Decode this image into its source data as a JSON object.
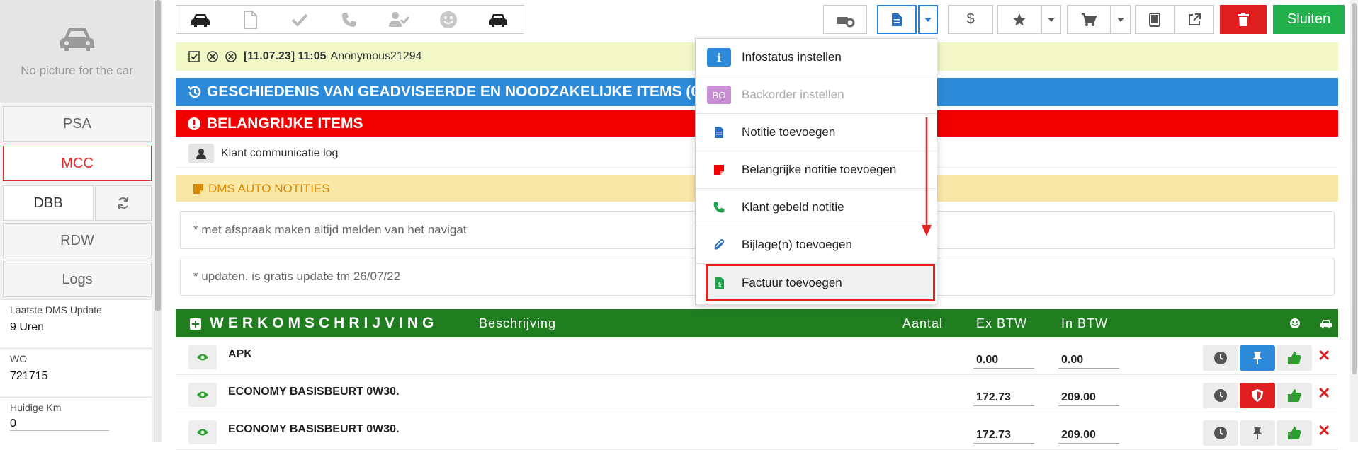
{
  "sidebar": {
    "no_picture": "No picture for the car",
    "buttons": {
      "psa": "PSA",
      "mcc": "MCC",
      "dbb": "DBB",
      "rdw": "RDW",
      "logs": "Logs"
    },
    "info": [
      {
        "label": "Laatste DMS Update",
        "value": "9 Uren"
      },
      {
        "label": "WO",
        "value": "721715"
      },
      {
        "label": "Huidige Km",
        "value": "0"
      }
    ]
  },
  "toolbar": {
    "close_label": "Sluiten",
    "icons": [
      "car-icon",
      "file-icon",
      "check-icon",
      "phone-icon",
      "user-check-icon",
      "smiley-icon",
      "car-icon",
      "car-key-icon",
      "document-icon",
      "dollar-icon",
      "star-icon",
      "cart-icon",
      "tablet-icon",
      "external-link-icon",
      "trash-icon"
    ]
  },
  "info_row": {
    "date": "[11.07.23] 11:05",
    "user": "Anonymous21294"
  },
  "bands": {
    "history": "GESCHIEDENIS VAN GEADVISEERDE EN NOODZAKELIJKE ITEMS (0)",
    "important": "BELANGRIJKE ITEMS",
    "klant_log": "Klant communicatie log",
    "dms_auto": "DMS AUTO NOTITIES"
  },
  "notes": [
    "* met afspraak maken altijd melden van het navigat",
    "* updaten. is gratis update tm 26/07/22"
  ],
  "werk": {
    "title": "WERKOMSCHRIJVING",
    "col_desc": "Beschrijving",
    "col_qty": "Aantal",
    "col_ex": "Ex BTW",
    "col_in": "In BTW"
  },
  "items": [
    {
      "name": "APK",
      "ex": "0.00",
      "in": "0.00"
    },
    {
      "name": "ECONOMY BASISBEURT 0W30.",
      "ex": "172.73",
      "in": "209.00"
    },
    {
      "name": "ECONOMY BASISBEURT 0W30.",
      "ex": "172.73",
      "in": "209.00"
    }
  ],
  "menu": {
    "items": [
      {
        "label": "Infostatus instellen",
        "icon": "info-icon"
      },
      {
        "label": "Backorder instellen",
        "icon": "bo-badge-icon",
        "badge": "BO"
      },
      {
        "label": "Notitie toevoegen",
        "icon": "note-icon"
      },
      {
        "label": "Belangrijke notitie toevoegen",
        "icon": "important-note-icon"
      },
      {
        "label": "Klant gebeld notitie",
        "icon": "phone-icon"
      },
      {
        "label": "Bijlage(n) toevoegen",
        "icon": "paperclip-icon"
      },
      {
        "label": "Factuur toevoegen",
        "icon": "invoice-icon"
      }
    ]
  },
  "colors": {
    "blue": "#2c8ad8",
    "red": "#f20000",
    "green": "#1f7d20",
    "yellow": "#f9e7a8",
    "highlight": "#e52222"
  }
}
